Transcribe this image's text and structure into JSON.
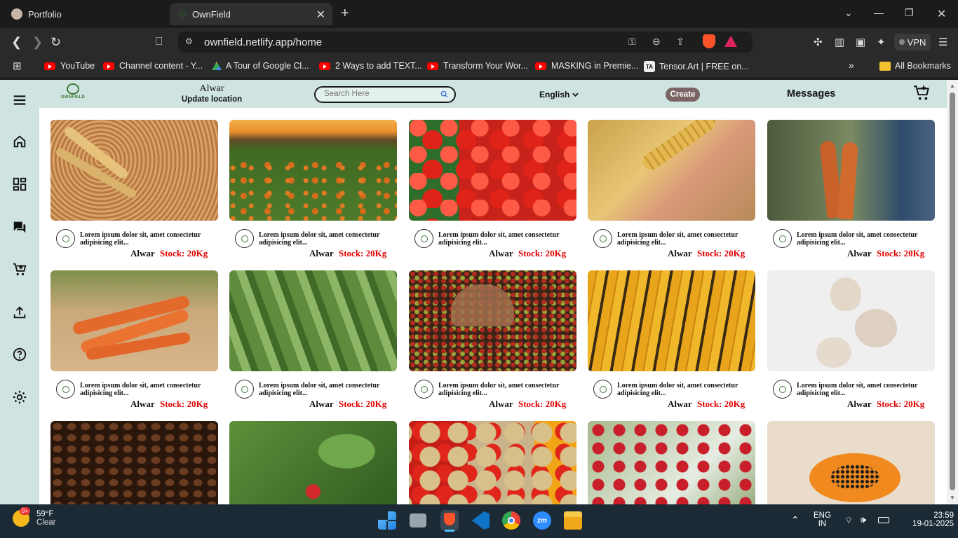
{
  "browser": {
    "tabs": [
      {
        "title": "Portfolio",
        "active": false
      },
      {
        "title": "OwnField",
        "active": true
      }
    ],
    "url": "ownfield.netlify.app/home",
    "vpn_label": "VPN",
    "bookmarks": [
      {
        "label": "YouTube",
        "icon": "youtube-icon"
      },
      {
        "label": "Channel content - Y...",
        "icon": "youtube-icon"
      },
      {
        "label": "A Tour of Google Cl...",
        "icon": "google-cloud-icon"
      },
      {
        "label": "2 Ways to add TEXT...",
        "icon": "youtube-icon"
      },
      {
        "label": "Transform Your Wor...",
        "icon": "youtube-icon"
      },
      {
        "label": "MASKING in Premie...",
        "icon": "youtube-icon"
      },
      {
        "label": "Tensor.Art | FREE on...",
        "icon": "tensorart-icon"
      }
    ],
    "all_bookmarks": "All Bookmarks",
    "overflow": "»"
  },
  "header": {
    "logo_text": "OWNFIELD",
    "city": "Alwar",
    "update_location": "Update location",
    "search_placeholder": "Search Here",
    "language": "English",
    "create": "Create",
    "messages": "Messages"
  },
  "sidebar_icons": [
    "menu-icon",
    "home-icon",
    "dashboard-icon",
    "chat-icon",
    "add-cart-icon",
    "upload-icon",
    "help-icon",
    "settings-icon"
  ],
  "products": [
    {
      "desc": "Lorem ipsum dolor sit, amet consectetur adipisicing elit...",
      "city": "Alwar",
      "stock": "Stock: 20Kg",
      "image": "wheat"
    },
    {
      "desc": "Lorem ipsum dolor sit, amet consectetur adipisicing elit...",
      "city": "Alwar",
      "stock": "Stock: 20Kg",
      "image": "pumpkin-field"
    },
    {
      "desc": "Lorem ipsum dolor sit, amet consectetur adipisicing elit...",
      "city": "Alwar",
      "stock": "Stock: 20Kg",
      "image": "tomatoes"
    },
    {
      "desc": "Lorem ipsum dolor sit, amet consectetur adipisicing elit...",
      "city": "Alwar",
      "stock": "Stock: 20Kg",
      "image": "rice"
    },
    {
      "desc": "Lorem ipsum dolor sit, amet consectetur adipisicing elit...",
      "city": "Alwar",
      "stock": "Stock: 20Kg",
      "image": "fresh-carrots"
    },
    {
      "desc": "Lorem ipsum dolor sit, amet consectetur adipisicing elit...",
      "city": "Alwar",
      "stock": "Stock: 20Kg",
      "image": "carrots"
    },
    {
      "desc": "Lorem ipsum dolor sit, amet consectetur adipisicing elit...",
      "city": "Alwar",
      "stock": "Stock: 20Kg",
      "image": "cucumbers"
    },
    {
      "desc": "Lorem ipsum dolor sit, amet consectetur adipisicing elit...",
      "city": "Alwar",
      "stock": "Stock: 20Kg",
      "image": "coffee-cherries"
    },
    {
      "desc": "Lorem ipsum dolor sit, amet consectetur adipisicing elit...",
      "city": "Alwar",
      "stock": "Stock: 20Kg",
      "image": "corn"
    },
    {
      "desc": "Lorem ipsum dolor sit, amet consectetur adipisicing elit...",
      "city": "Alwar",
      "stock": "Stock: 20Kg",
      "image": "garlic"
    },
    {
      "image": "coffee-beans"
    },
    {
      "image": "strawberry"
    },
    {
      "image": "vegetables"
    },
    {
      "image": "apples"
    },
    {
      "image": "papaya"
    }
  ],
  "taskbar": {
    "temperature": "59°F",
    "condition": "Clear",
    "badge": "9+",
    "lang_top": "ENG",
    "lang_bottom": "IN",
    "time": "23:59",
    "date": "19-01-2025"
  },
  "colors": {
    "accent_bg": "#cfe3e0",
    "stock_red": "#e00000",
    "create_btn": "#7a6464"
  }
}
